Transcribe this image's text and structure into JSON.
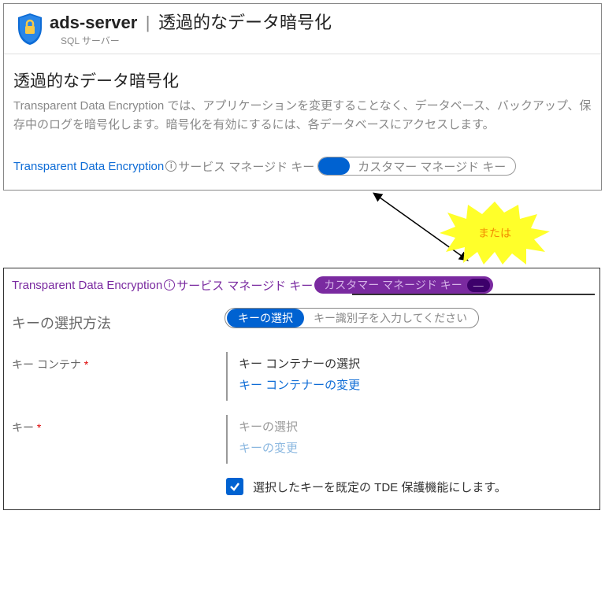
{
  "header": {
    "server_name": "ads-server",
    "page_title": "透過的なデータ暗号化",
    "subtitle": "SQL サーバー"
  },
  "panel1": {
    "section_heading": "透過的なデータ暗号化",
    "description": "Transparent Data Encryption では、アプリケーションを変更することなく、データベース、バックアップ、保存中のログを暗号化します。暗号化を有効にするには、各データベースにアクセスします。",
    "link_text": "Transparent Data Encryption",
    "service_key_label": "サービス マネージド キー",
    "customer_key_label": "カスタマー マネージド キー"
  },
  "connector": {
    "or_label": "または"
  },
  "panel2": {
    "link_text": "Transparent Data Encryption",
    "service_key_label": "サービス マネージド キー",
    "customer_key_label": "カスタマー マネージド キー",
    "selection_method_label": "キーの選択方法",
    "select_key_pill": "キーの選択",
    "enter_key_id_text": "キー識別子を入力してください",
    "container_label": "キー コンテナ",
    "container_block_title": "キー コンテナーの選択",
    "container_block_link": "キー コンテナーの変更",
    "key_label": "キー",
    "key_block_title": "キーの選択",
    "key_block_link": "キーの変更",
    "checkbox_label": "選択したキーを既定の TDE 保護機能にします。"
  }
}
